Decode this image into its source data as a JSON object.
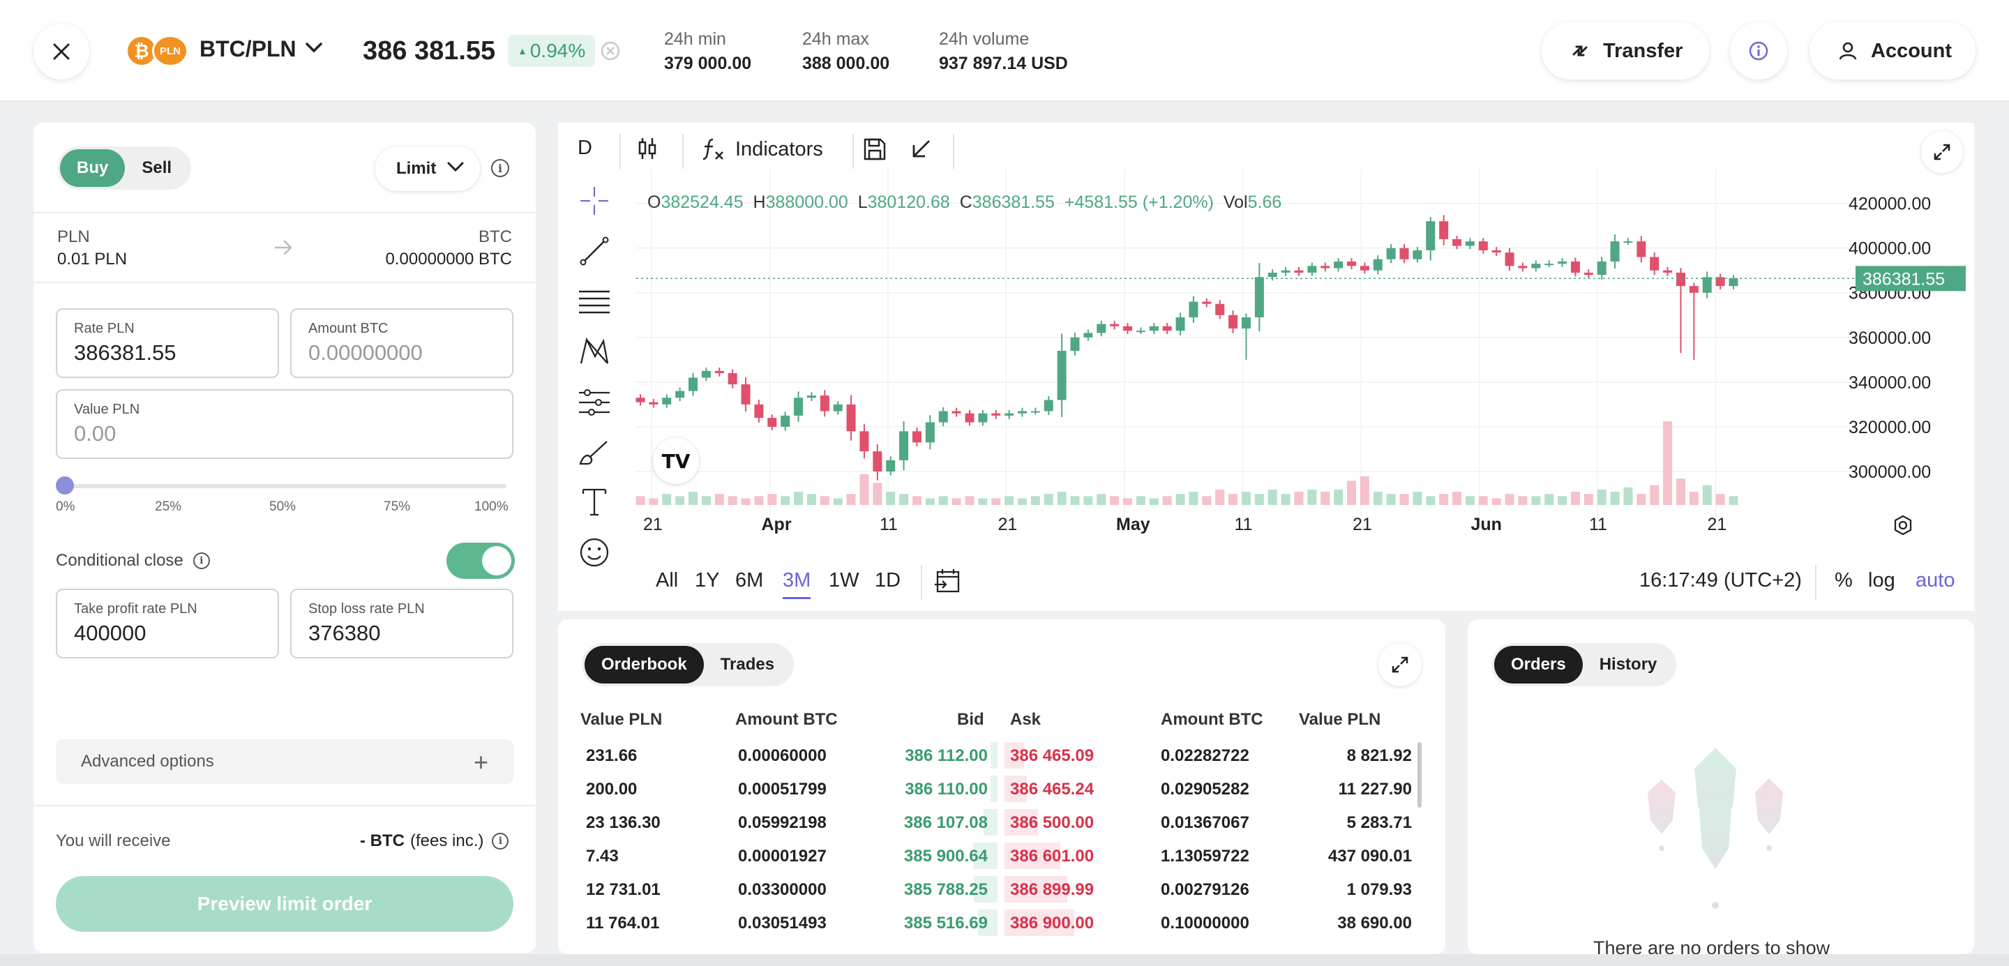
{
  "header": {
    "pair": "BTC/PLN",
    "coin_base_symbol": "₿",
    "coin_quote_label": "PLN",
    "price": "386 381.55",
    "change": "0.94%",
    "stats": [
      {
        "label": "24h min",
        "value": "379 000.00"
      },
      {
        "label": "24h max",
        "value": "388 000.00"
      },
      {
        "label": "24h volume",
        "value": "937 897.14 USD"
      }
    ],
    "transfer_label": "Transfer",
    "account_label": "Account"
  },
  "order_form": {
    "side_buy": "Buy",
    "side_sell": "Sell",
    "order_type": "Limit",
    "from_currency": "PLN",
    "from_value": "0.01 PLN",
    "to_currency": "BTC",
    "to_value": "0.00000000 BTC",
    "rate_label": "Rate PLN",
    "rate_value": "386381.55",
    "amount_label": "Amount BTC",
    "amount_placeholder": "0.00000000",
    "value_label": "Value PLN",
    "value_placeholder": "0.00",
    "slider_level": 0,
    "slider_marks": [
      "0%",
      "25%",
      "50%",
      "75%",
      "100%"
    ],
    "conditional_close_label": "Conditional close",
    "conditional_close_on": true,
    "take_profit_label": "Take profit rate PLN",
    "take_profit_value": "400000",
    "stop_loss_label": "Stop loss rate PLN",
    "stop_loss_value": "376380",
    "advanced_label": "Advanced options",
    "receive_label": "You will receive",
    "receive_value": "- BTC",
    "receive_suffix": "(fees inc.)",
    "preview_button": "Preview limit order"
  },
  "chart_toolbar": {
    "interval": "D",
    "indicators_label": "Indicators"
  },
  "chart_data": {
    "type": "candlestick",
    "ohlc_legend": {
      "o_label": "O",
      "o": "382524.45",
      "h_label": "H",
      "h": "388000.00",
      "l_label": "L",
      "l": "380120.68",
      "c_label": "C",
      "c": "386381.55",
      "change": "+4581.55 (+1.20%)",
      "vol_label": "Vol",
      "vol": "5.66"
    },
    "y_ticks": [
      "420000.00",
      "400000.00",
      "380000.00",
      "360000.00",
      "340000.00",
      "320000.00",
      "300000.00"
    ],
    "ylim": [
      285000,
      428000
    ],
    "x_ticks": [
      "21",
      "Apr",
      "11",
      "21",
      "May",
      "11",
      "21",
      "Jun",
      "11",
      "21"
    ],
    "last_price_label": "386381.55",
    "last_price": 386381.55,
    "closes": [
      331000,
      330000,
      333000,
      336000,
      342000,
      345000,
      344000,
      339000,
      330000,
      324000,
      320000,
      325000,
      333000,
      334000,
      327000,
      330000,
      318000,
      309000,
      300000,
      305000,
      318000,
      313000,
      322000,
      327000,
      326000,
      322000,
      326000,
      325000,
      326000,
      327000,
      327000,
      332000,
      354000,
      360000,
      362000,
      366000,
      365000,
      363000,
      363000,
      365000,
      363000,
      369000,
      376000,
      375000,
      370000,
      364000,
      369000,
      387000,
      389000,
      390000,
      389000,
      392000,
      391000,
      394000,
      392000,
      390000,
      395000,
      400000,
      395000,
      399000,
      412000,
      404000,
      401000,
      403000,
      399000,
      398000,
      392000,
      391000,
      393000,
      393000,
      394000,
      389000,
      388000,
      394000,
      403000,
      403000,
      396000,
      390000,
      389000,
      383000,
      380000,
      387000,
      383000,
      386381.55
    ],
    "volumes": [
      4,
      3,
      5,
      4,
      6,
      4,
      5,
      4,
      3,
      4,
      5,
      4,
      6,
      5,
      4,
      3,
      5,
      14,
      10,
      6,
      5,
      4,
      3,
      4,
      3,
      4,
      3,
      3,
      4,
      3,
      4,
      5,
      6,
      4,
      4,
      5,
      4,
      3,
      4,
      3,
      4,
      5,
      6,
      4,
      7,
      5,
      6,
      5,
      7,
      5,
      6,
      7,
      6,
      7,
      11,
      13,
      6,
      5,
      5,
      6,
      4,
      5,
      6,
      4,
      4,
      3,
      5,
      4,
      4,
      5,
      4,
      6,
      5,
      7,
      6,
      8,
      5,
      9,
      38,
      12,
      6,
      9,
      5,
      4
    ],
    "time_display": "16:17:49 (UTC+2)",
    "scale_options": [
      "%",
      "log",
      "auto"
    ]
  },
  "range_buttons": [
    "All",
    "1Y",
    "6M",
    "3M",
    "1W",
    "1D"
  ],
  "range_active": "3M",
  "orderbook": {
    "tab_active": "Orderbook",
    "tab_other": "Trades",
    "headers": [
      "Value PLN",
      "Amount BTC",
      "Bid",
      "Ask",
      "Amount BTC",
      "Value PLN"
    ],
    "rows": [
      [
        "231.66",
        "0.00060000",
        "386 112.00",
        "386 465.09",
        "0.02282722",
        "8 821.92"
      ],
      [
        "200.00",
        "0.00051799",
        "386 110.00",
        "386 465.24",
        "0.02905282",
        "11 227.90"
      ],
      [
        "23 136.30",
        "0.05992198",
        "386 107.08",
        "386 500.00",
        "0.01367067",
        "5 283.71"
      ],
      [
        "7.43",
        "0.00001927",
        "385 900.64",
        "386 601.00",
        "1.13059722",
        "437 090.01"
      ],
      [
        "12 731.01",
        "0.03300000",
        "385 788.25",
        "386 899.99",
        "0.00279126",
        "1 079.93"
      ],
      [
        "11 764.01",
        "0.03051493",
        "385 516.69",
        "386 900.00",
        "0.10000000",
        "38 690.00"
      ]
    ]
  },
  "orders": {
    "tab_active": "Orders",
    "tab_other": "History",
    "empty_text": "There are no orders to show"
  },
  "colors": {
    "up": "#4fa783",
    "down": "#e0506a",
    "accent": "#6965d8"
  }
}
